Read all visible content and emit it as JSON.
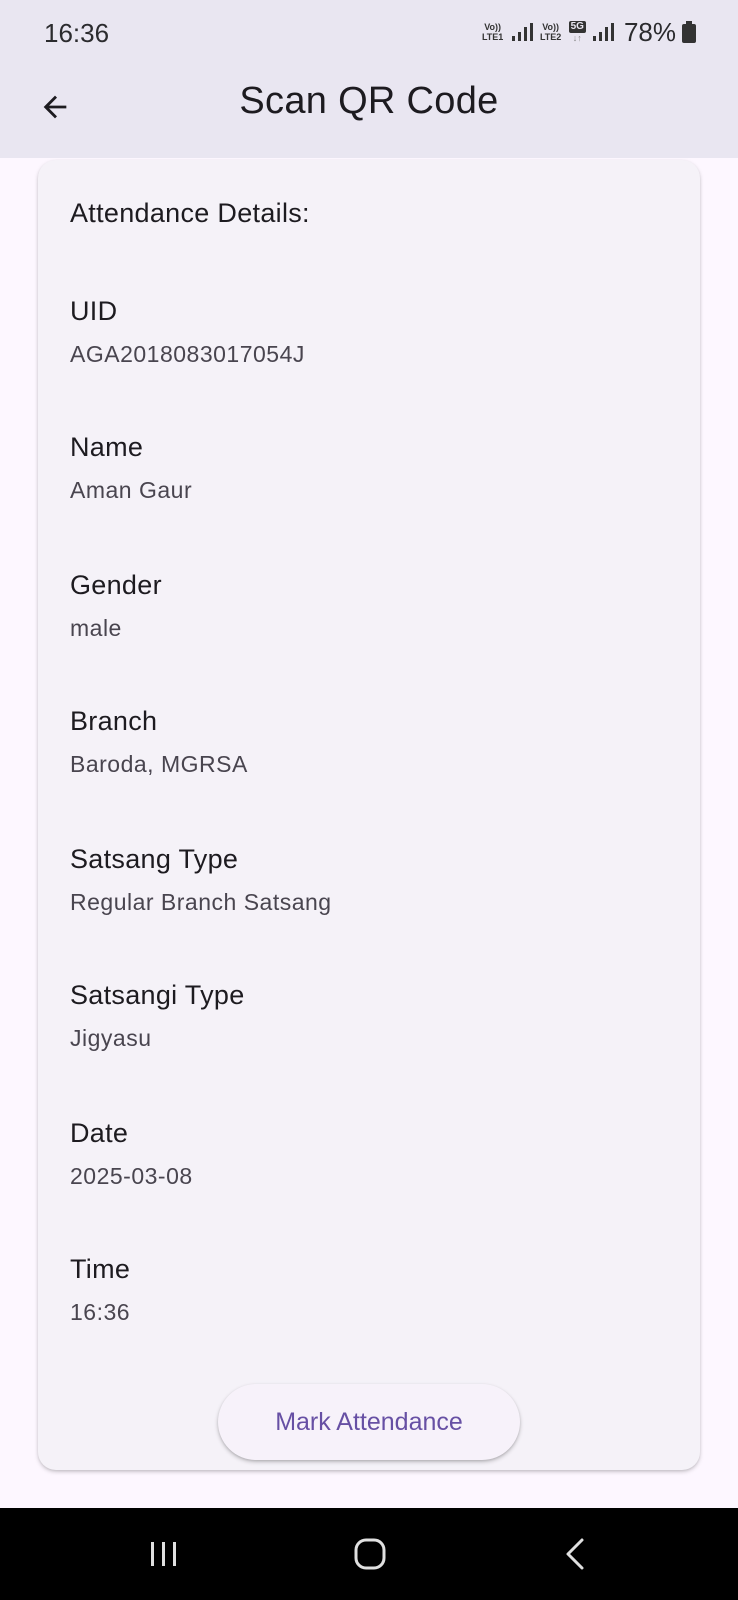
{
  "status_bar": {
    "time": "16:36",
    "sim1_label": "Vo)) LTE1",
    "sim2_label": "Vo)) LTE2",
    "network_type": "5G",
    "battery_percent": "78%"
  },
  "app_bar": {
    "title": "Scan QR Code",
    "back_icon": "arrow-back-icon"
  },
  "card": {
    "heading": "Attendance Details:",
    "fields": [
      {
        "label": "UID",
        "value": "AGA2018083017054J"
      },
      {
        "label": "Name",
        "value": "Aman Gaur"
      },
      {
        "label": "Gender",
        "value": "male"
      },
      {
        "label": "Branch",
        "value": "Baroda, MGRSA"
      },
      {
        "label": "Satsang Type",
        "value": "Regular Branch Satsang"
      },
      {
        "label": "Satsangi Type",
        "value": "Jigyasu"
      },
      {
        "label": "Date",
        "value": "2025-03-08"
      },
      {
        "label": "Time",
        "value": "16:36"
      }
    ],
    "button_label": "Mark Attendance"
  },
  "nav_bar": {
    "icons": [
      "recent-apps-icon",
      "home-icon",
      "back-nav-icon"
    ]
  },
  "colors": {
    "app_bar_bg": "#e9e6f1",
    "page_bg": "#fdf7ff",
    "card_bg": "#f5f2f8",
    "button_text": "#6750a4"
  }
}
